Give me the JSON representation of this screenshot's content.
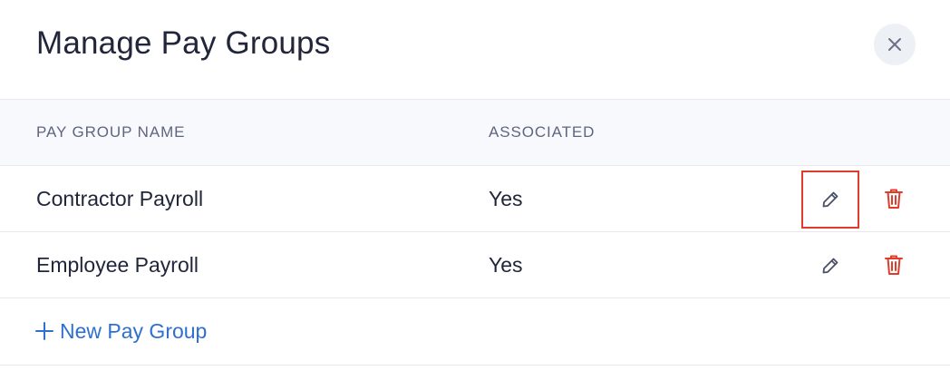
{
  "dialog": {
    "title": "Manage Pay Groups"
  },
  "table": {
    "headers": {
      "name": "PAY GROUP NAME",
      "associated": "ASSOCIATED"
    },
    "rows": [
      {
        "name": "Contractor Payroll",
        "associated": "Yes"
      },
      {
        "name": "Employee Payroll",
        "associated": "Yes"
      }
    ]
  },
  "add_link": {
    "label": "New Pay Group"
  },
  "colors": {
    "accent": "#2f6fcf",
    "danger": "#e03c2c",
    "text": "#21263a",
    "muted": "#5f6580"
  },
  "icons": {
    "close": "close-icon",
    "edit": "pencil-icon",
    "delete": "trash-icon",
    "add": "plus-icon"
  }
}
